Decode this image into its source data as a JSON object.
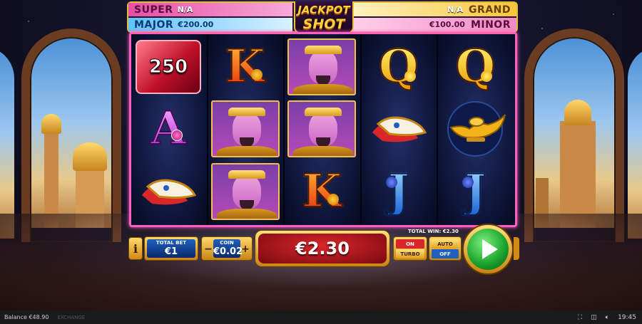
{
  "jackpots": {
    "super": {
      "name": "SUPER",
      "value": "N/A"
    },
    "major": {
      "name": "MAJOR",
      "value": "€200.00"
    },
    "grand": {
      "name": "GRAND",
      "value": "N/A"
    },
    "minor": {
      "name": "MINOR",
      "value": "€100.00"
    },
    "logo_line1": "JACKPOT",
    "logo_line2": "SHOT"
  },
  "reels": [
    [
      "jewel-250",
      "genie-a",
      "shoes"
    ],
    [
      "K",
      "genie-b",
      "genie-c"
    ],
    [
      "genie-d",
      "genie-e",
      "K"
    ],
    [
      "Q",
      "shoes",
      "J"
    ],
    [
      "Q",
      "lamp",
      "J"
    ]
  ],
  "jewel_value": "250",
  "letters": {
    "K": "K",
    "Q": "Q",
    "A": "A",
    "J": "J"
  },
  "controls": {
    "info_label": "i",
    "total_bet_label": "TOTAL BET",
    "total_bet_value": "€1",
    "coin_label": "COIN",
    "coin_value": "€0.02",
    "minus_label": "−",
    "plus_label": "+",
    "win_value": "€2.30",
    "total_win_text": "TOTAL WIN: €2.30",
    "turbo_on": "ON",
    "turbo_label": "TURBO",
    "auto_label": "AUTO",
    "auto_off": "OFF"
  },
  "status": {
    "balance": "Balance €48.90",
    "brand": "EXCHANGE",
    "time": "19:45"
  },
  "colors": {
    "reel_border": "#ff5fc0",
    "spin_green": "#17a02a",
    "win_red": "#d8262a",
    "gold": "#e9b93b"
  }
}
